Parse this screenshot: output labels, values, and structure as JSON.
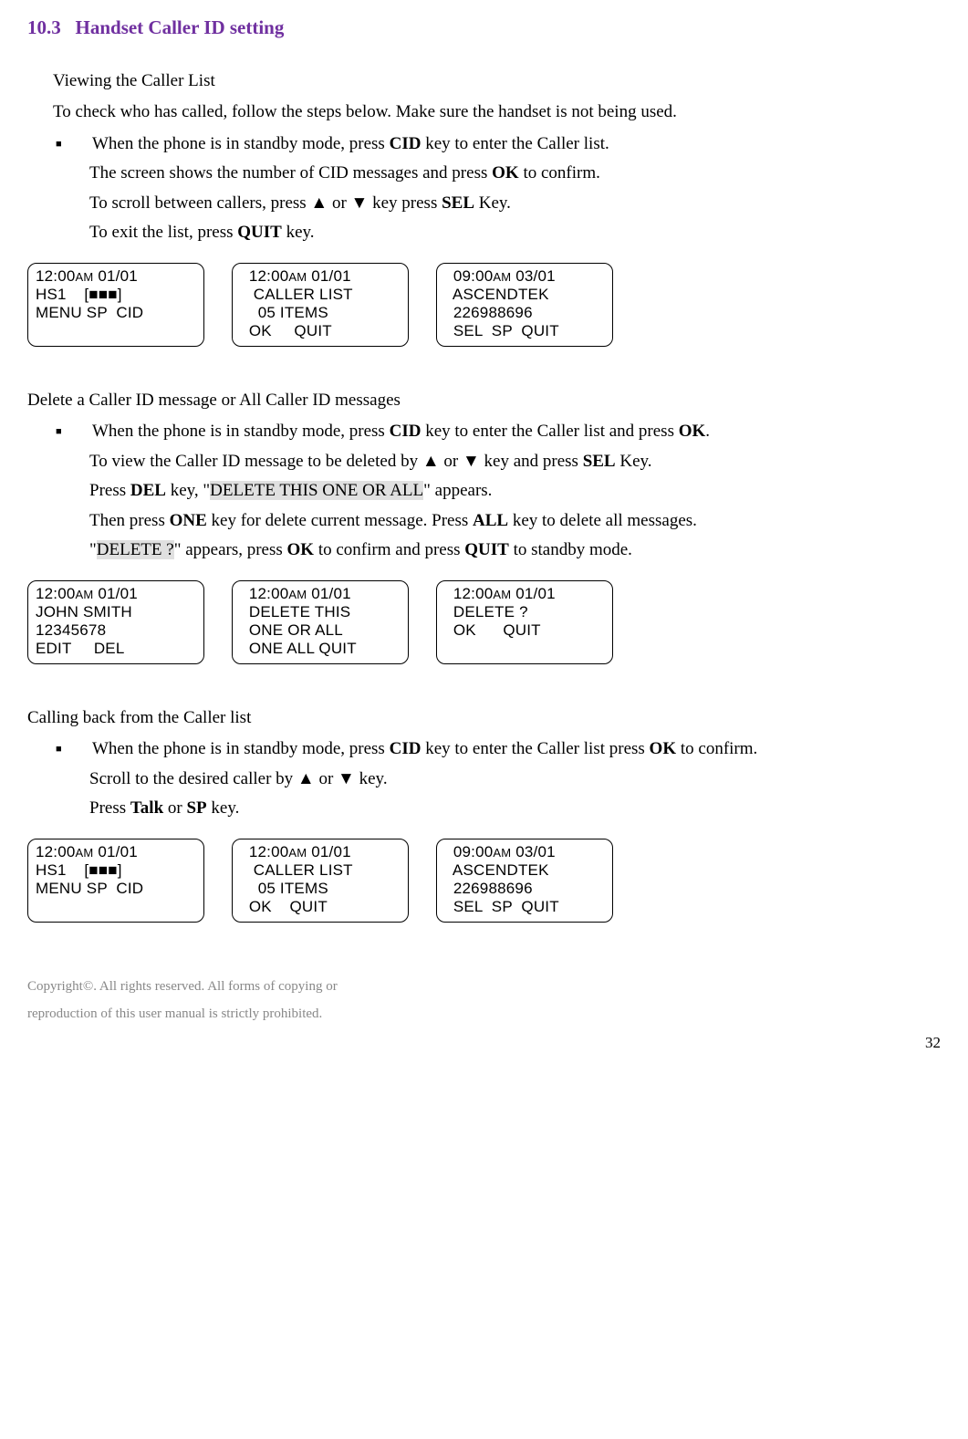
{
  "section": {
    "number": "10.3",
    "title": "Handset Caller ID setting"
  },
  "sub1": {
    "heading": "Viewing the Caller List",
    "intro": "To check who has called, follow the steps below. Make sure the handset is not being used.",
    "b1_a": "When the phone is in standby mode, press ",
    "b1_cid": "CID",
    "b1_b": " key to enter the Caller list.",
    "l2_a": "The screen shows the number of CID messages and press ",
    "l2_ok": "OK",
    "l2_b": " to confirm.",
    "l3_a": "To scroll between callers, press ▲ or ▼ key press ",
    "l3_sel": "SEL",
    "l3_b": " Key.",
    "l4_a": "To exit the list, press ",
    "l4_quit": "QUIT",
    "l4_b": " key."
  },
  "screens1": [
    {
      "l1": "12:00",
      "l1s": "AM",
      "l1b": " 01/01",
      "l2": "HS1    [■■■]",
      "l3": "",
      "l4": "MENU SP  CID"
    },
    {
      "l1": "  12:00",
      "l1s": "AM",
      "l1b": " 01/01",
      "l2": "   CALLER LIST",
      "l3": "    05 ITEMS",
      "l4": "  OK     QUIT"
    },
    {
      "l1": "  09:00",
      "l1s": "AM",
      "l1b": " 03/01",
      "l2": "  ASCENDTEK",
      "l3": "  226988696",
      "l4": "  SEL  SP  QUIT"
    }
  ],
  "sub2": {
    "heading": "Delete a Caller ID message or All Caller ID messages",
    "b1_a": "When the phone is in standby mode, press ",
    "b1_cid": "CID",
    "b1_b": " key to enter the Caller list and press ",
    "b1_ok": "OK",
    "b1_c": ".",
    "l2_a": "To view the Caller ID message to be deleted by ▲ or ▼ key and press ",
    "l2_sel": "SEL",
    "l2_b": " Key.",
    "l3_a": "Press ",
    "l3_del": "DEL",
    "l3_b": " key, \"",
    "l3_hl": "DELETE THIS ONE OR ALL",
    "l3_c": "\" appears.",
    "l4_a": "Then press ",
    "l4_one": "ONE",
    "l4_b": " key for delete current message. Press ",
    "l4_all": "ALL",
    "l4_c": " key to delete all messages.",
    "l5_a": "\"",
    "l5_hl": "DELETE ?",
    "l5_b": "\" appears, press ",
    "l5_ok": "OK",
    "l5_c": " to confirm and press ",
    "l5_quit": "QUIT",
    "l5_d": " to standby mode."
  },
  "screens2": [
    {
      "l1": "12:00",
      "l1s": "AM",
      "l1b": " 01/01",
      "l2": "JOHN SMITH",
      "l3": "12345678",
      "l4": "EDIT     DEL"
    },
    {
      "l1": "  12:00",
      "l1s": "AM",
      "l1b": " 01/01",
      "l2": "  DELETE THIS",
      "l3": "  ONE OR ALL",
      "l4": "  ONE ALL QUIT"
    },
    {
      "l1": "  12:00",
      "l1s": "AM",
      "l1b": " 01/01",
      "l2": "  DELETE ?",
      "l3": "",
      "l4": "  OK      QUIT"
    }
  ],
  "sub3": {
    "heading": "Calling back from the Caller list",
    "b1_a": "When the phone is in standby mode, press ",
    "b1_cid": "CID",
    "b1_b": " key to enter the Caller list press ",
    "b1_ok": "OK",
    "b1_c": " to confirm.",
    "l2": "Scroll to the desired caller by ▲ or ▼ key.",
    "l3_a": "Press ",
    "l3_talk": "Talk",
    "l3_b": " or ",
    "l3_sp": "SP",
    "l3_c": " key."
  },
  "screens3": [
    {
      "l1": "12:00",
      "l1s": "AM",
      "l1b": " 01/01",
      "l2": "HS1    [■■■]",
      "l3": "",
      "l4": "MENU SP  CID"
    },
    {
      "l1": "  12:00",
      "l1s": "AM",
      "l1b": " 01/01",
      "l2": "   CALLER LIST",
      "l3": "    05 ITEMS",
      "l4": "  OK    QUIT"
    },
    {
      "l1": "  09:00",
      "l1s": "AM",
      "l1b": " 03/01",
      "l2": "  ASCENDTEK",
      "l3": "  226988696",
      "l4": "  SEL  SP  QUIT"
    }
  ],
  "footer1": "Copyright©. All rights reserved. All forms of copying or",
  "footer2": "reproduction of this user manual is strictly prohibited.",
  "pagenum": "32"
}
